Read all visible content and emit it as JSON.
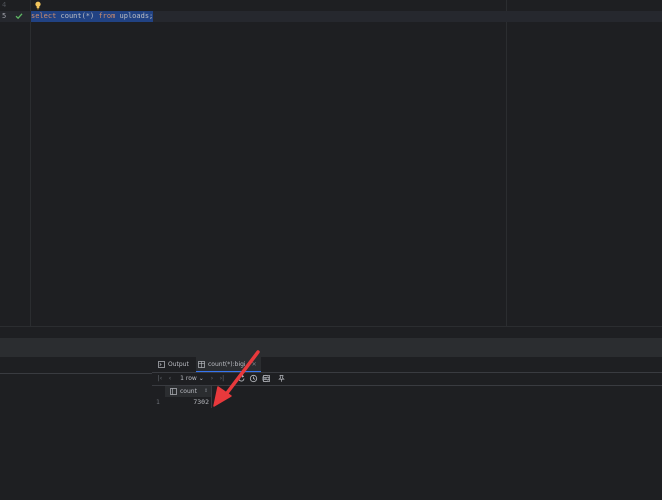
{
  "editor": {
    "lines": [
      {
        "number": "4",
        "tokens": []
      },
      {
        "number": "5",
        "tokens": [
          {
            "text": "select",
            "kind": "keyword"
          },
          {
            "text": " count(*) ",
            "kind": "ident"
          },
          {
            "text": "from",
            "kind": "keyword"
          },
          {
            "text": " uploads;",
            "kind": "ident"
          }
        ]
      }
    ],
    "status_icon": "checkmark-icon",
    "hint_icon": "lightbulb-icon"
  },
  "results": {
    "tabs": [
      {
        "label": "Output",
        "icon": "output-console-icon"
      },
      {
        "label": "count(*):bigi",
        "icon": "table-grid-icon"
      }
    ],
    "toolbar": {
      "rows_label": "1 row",
      "icons": [
        "first-page-icon",
        "previous-page-icon",
        "rows-dropdown-icon",
        "next-page-icon",
        "last-page-icon",
        "refresh-icon",
        "history-icon",
        "stop-icon",
        "table-view-icon",
        "pin-icon"
      ]
    },
    "columns": [
      {
        "name": "count",
        "icon": "column-icon"
      }
    ],
    "rows": [
      {
        "number": "1",
        "values": [
          "7302"
        ]
      }
    ]
  },
  "annotation": {
    "type": "arrow",
    "color": "#e8393c"
  }
}
